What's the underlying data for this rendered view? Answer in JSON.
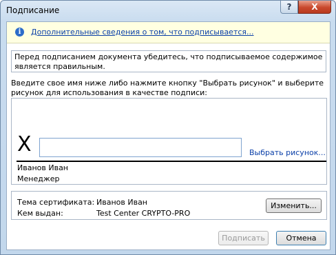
{
  "window": {
    "title": "Подписание",
    "help_label": "?",
    "close_label": "X"
  },
  "infobar": {
    "icon": "info-icon",
    "link_text": "Дополнительные сведения о том, что подписывается..."
  },
  "notice": "Перед подписанием документа убедитесь, что подписываемое содержимое является правильным.",
  "instruction": "Введите свое имя ниже либо нажмите кнопку \"Выбрать рисунок\" и выберите рисунок для использования в качестве подписи:",
  "signature": {
    "x_mark": "X",
    "name_input_value": "",
    "choose_image_link": "Выбрать рисунок...",
    "signer_name": "Иванов Иван",
    "signer_title": "Менеджер"
  },
  "certificate": {
    "subject_label": "Тема сертификата:",
    "subject_value": "Иванов Иван",
    "issuer_label": "Кем выдан:",
    "issuer_value": "Test Center CRYPTO-PRO",
    "change_button": "Изменить..."
  },
  "buttons": {
    "sign": "Подписать",
    "cancel": "Отмена"
  }
}
